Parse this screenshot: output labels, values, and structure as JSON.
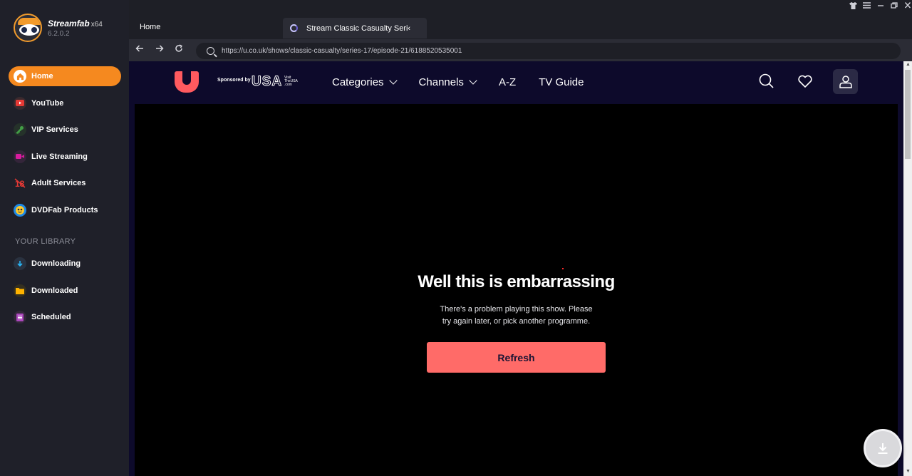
{
  "app": {
    "name": "Streamfab",
    "arch": "x64",
    "version": "6.2.0.2"
  },
  "sidebar": {
    "items": [
      {
        "label": "Home",
        "icon": "home-icon",
        "color": "#f5891f"
      },
      {
        "label": "YouTube",
        "icon": "youtube-icon",
        "color": "#e53935"
      },
      {
        "label": "VIP Services",
        "icon": "key-icon",
        "color": "#43a047"
      },
      {
        "label": "Live Streaming",
        "icon": "camera-icon",
        "color": "#d81b9e"
      },
      {
        "label": "Adult Services",
        "icon": "adult-18-icon",
        "color": "#e53935"
      },
      {
        "label": "DVDFab Products",
        "icon": "dvdfab-icon",
        "color": "#1e88e5"
      }
    ],
    "library_label": "YOUR LIBRARY",
    "library": [
      {
        "label": "Downloading",
        "icon": "download-arrow-icon",
        "color": "#29b6f6"
      },
      {
        "label": "Downloaded",
        "icon": "folder-icon",
        "color": "#ffb300"
      },
      {
        "label": "Scheduled",
        "icon": "calendar-list-icon",
        "color": "#ab47bc"
      }
    ]
  },
  "tabs": {
    "home": "Home",
    "active": "Stream Classic Casualty Seri‹"
  },
  "browser": {
    "url": "https://u.co.uk/shows/classic-casualty/series-17/episode-21/6188520535001"
  },
  "site": {
    "sponsored_by": "Sponsored by",
    "sponsor_brand": "USA",
    "sponsor_visit": "Visit TheUSA .com",
    "nav": {
      "categories": "Categories",
      "channels": "Channels",
      "az": "A-Z",
      "tv_guide": "TV Guide"
    },
    "brand_color": "#ff5a5f"
  },
  "player": {
    "error_title": "Well this is embarrassing",
    "error_line1": "There's a problem playing this show. Please",
    "error_line2": "try again later, or pick another programme.",
    "refresh_label": "Refresh"
  }
}
